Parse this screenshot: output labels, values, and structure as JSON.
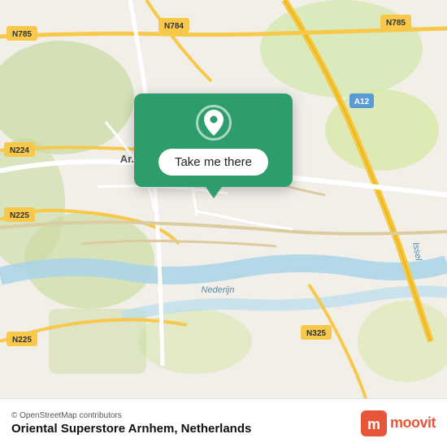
{
  "map": {
    "background_color": "#f2efe9",
    "alt": "OpenStreetMap of Arnhem, Netherlands"
  },
  "popup": {
    "button_label": "Take me there",
    "pin_icon": "location-pin"
  },
  "footer": {
    "copyright": "© OpenStreetMap contributors",
    "location_name": "Oriental Superstore Arnhem, Netherlands",
    "logo_name": "moovit",
    "logo_text": "moovit"
  },
  "road_labels": {
    "n785_top_left": "N785",
    "n784": "N784",
    "n785_top_right": "N785",
    "n224": "N224",
    "a12": "A12",
    "n225_left": "N225",
    "n225_bottom": "N225",
    "n325": "N325",
    "issel": "Issel",
    "nederijn": "Nederijn",
    "arnhem": "Ar..."
  }
}
